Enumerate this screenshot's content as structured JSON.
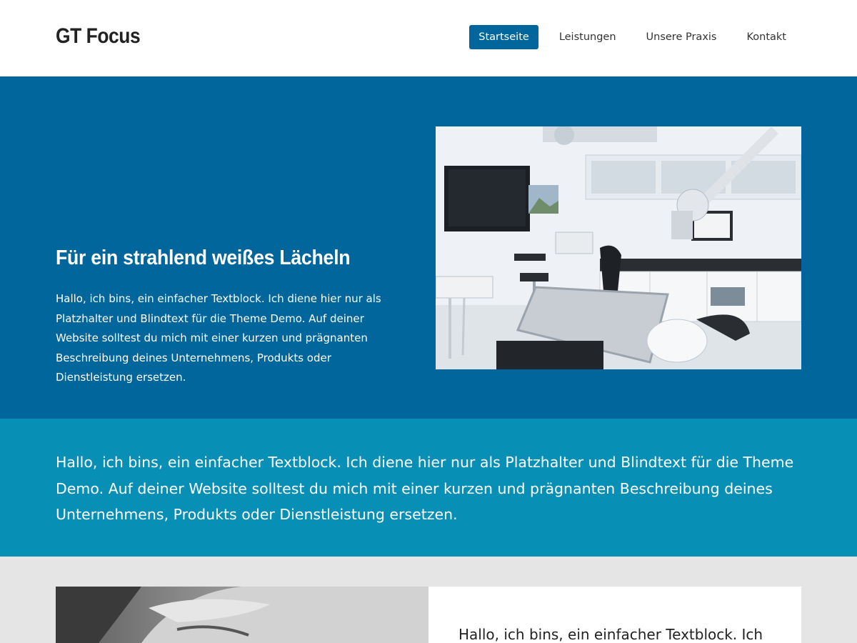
{
  "site": {
    "logo": "GT Focus"
  },
  "nav": {
    "items": [
      {
        "label": "Startseite",
        "active": true
      },
      {
        "label": "Leistungen",
        "active": false
      },
      {
        "label": "Unsere Praxis",
        "active": false
      },
      {
        "label": "Kontakt",
        "active": false
      }
    ]
  },
  "hero": {
    "title": "Für ein strahlend weißes Lächeln",
    "text": "Hallo, ich bins, ein einfacher Textblock. Ich diene hier nur als Platzhalter und Blindtext für die Theme Demo. Auf deiner Website solltest du mich mit einer kurzen und prägnanten Beschreibung deines Unternehmens, Produkts oder Dienstleistung ersetzen.",
    "image_icon": "dental-office-photo"
  },
  "banner": {
    "text": "Hallo, ich bins, ein einfacher Textblock. Ich diene hier nur als Platzhalter und Blindtext für die Theme Demo. Auf deiner Website solltest du mich mit einer kurzen und prägnanten Beschreibung deines Unternehmens, Produkts oder Dienstleistung ersetzen."
  },
  "feature": {
    "text": "Hallo, ich bins, ein einfacher Textblock. Ich",
    "image_icon": "smiling-face-photo"
  },
  "colors": {
    "primary": "#00669b",
    "banner": "#078fb6",
    "section_bg": "#e5e5e5"
  }
}
